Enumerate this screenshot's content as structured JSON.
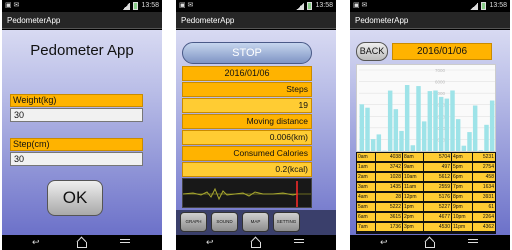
{
  "status": {
    "time": "13:58"
  },
  "screen1": {
    "app_title": "PedometerApp",
    "heading": "Pedometer App",
    "weight_label": "Weight(kg)",
    "weight_value": "30",
    "step_label": "Step(cm)",
    "step_value": "30",
    "ok_label": "OK"
  },
  "screen2": {
    "app_title": "PedometerApp",
    "stop_label": "STOP",
    "date": "2016/01/06",
    "steps_label": "Steps",
    "steps_value": "19",
    "distance_label": "Moving distance",
    "distance_value": "0.006(km)",
    "calories_label": "Consumed Calories",
    "calories_value": "0.2(kcal)",
    "tabs": [
      "GRAPH",
      "SOUND",
      "MAP",
      "SETTING"
    ]
  },
  "screen3": {
    "app_title": "PedometerApp",
    "back_label": "BACK",
    "date": "2016/01/06",
    "table": [
      [
        "0am",
        "4038",
        "8am",
        "5704",
        "4pm",
        "5231"
      ],
      [
        "1am",
        "3742",
        "9am",
        "497",
        "5pm",
        "2754"
      ],
      [
        "2am",
        "1028",
        "10am",
        "5612",
        "6pm",
        "458"
      ],
      [
        "3am",
        "1435",
        "11am",
        "2559",
        "7pm",
        "1634"
      ],
      [
        "4am",
        "28",
        "12pm",
        "5176",
        "8pm",
        "3931"
      ],
      [
        "5am",
        "5222",
        "1pm",
        "5227",
        "9pm",
        "61"
      ],
      [
        "6am",
        "3615",
        "2pm",
        "4677",
        "10pm",
        "2264"
      ],
      [
        "7am",
        "1736",
        "3pm",
        "4530",
        "11pm",
        "4362"
      ]
    ]
  },
  "chart_data": {
    "type": "bar",
    "categories": [
      "0am",
      "1am",
      "2am",
      "3am",
      "4am",
      "5am",
      "6am",
      "7am",
      "8am",
      "9am",
      "10am",
      "11am",
      "12pm",
      "1pm",
      "2pm",
      "3pm",
      "4pm",
      "5pm",
      "6pm",
      "7pm",
      "8pm",
      "9pm",
      "10pm",
      "11pm"
    ],
    "values": [
      4038,
      3742,
      1028,
      1435,
      28,
      5222,
      3615,
      1736,
      5704,
      497,
      5612,
      2559,
      5176,
      5227,
      4677,
      4530,
      5231,
      2754,
      458,
      1634,
      3931,
      61,
      2264,
      4362
    ],
    "ylim": [
      0,
      7000
    ],
    "yticks": [
      "7000",
      "6000",
      "5000",
      "4000",
      "3000",
      "2000",
      "1000"
    ],
    "grid": true,
    "color": "#9ee3e8"
  }
}
